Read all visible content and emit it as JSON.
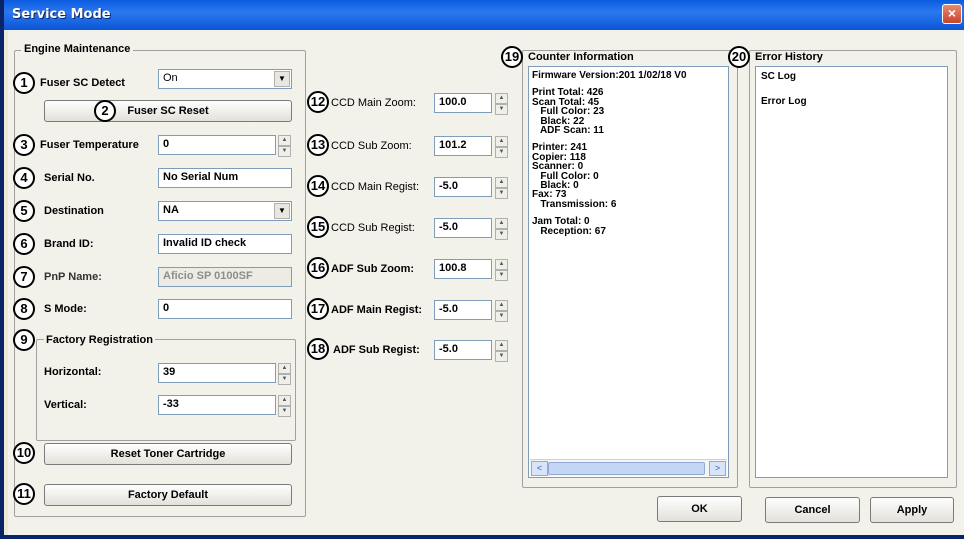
{
  "window": {
    "title": "Service Mode",
    "close": "×"
  },
  "engine": {
    "group_label": "Engine Maintenance",
    "fuser_sc_detect": {
      "label": "Fuser SC Detect",
      "value": "On"
    },
    "fuser_sc_reset": "Fuser SC Reset",
    "fuser_temperature": {
      "label": "Fuser Temperature",
      "value": "0"
    },
    "serial_no": {
      "label": "Serial No.",
      "value": "No Serial Num"
    },
    "destination": {
      "label": "Destination",
      "value": "NA"
    },
    "brand_id": {
      "label": "Brand ID:",
      "value": "Invalid ID check"
    },
    "pnp_name": {
      "label": "PnP Name:",
      "value": "Aficio SP 0100SF"
    },
    "s_mode": {
      "label": "S Mode:",
      "value": "0"
    },
    "factory_registration": {
      "group_label": "Factory Registration",
      "horizontal": {
        "label": "Horizontal:",
        "value": "39"
      },
      "vertical": {
        "label": "Vertical:",
        "value": "-33"
      }
    },
    "reset_toner": "Reset Toner Cartridge",
    "factory_default": "Factory Default"
  },
  "scanner": {
    "ccd_main_zoom": {
      "label": "CCD Main Zoom:",
      "value": "100.0"
    },
    "ccd_sub_zoom": {
      "label": "CCD Sub Zoom:",
      "value": "101.2"
    },
    "ccd_main_regist": {
      "label": "CCD Main Regist:",
      "value": "-5.0"
    },
    "ccd_sub_regist": {
      "label": "CCD Sub Regist:",
      "value": "-5.0"
    },
    "adf_sub_zoom": {
      "label": "ADF Sub Zoom:",
      "value": "100.8"
    },
    "adf_main_regist": {
      "label": "ADF Main Regist:",
      "value": "-5.0"
    },
    "adf_sub_regist": {
      "label": "ADF Sub Regist:",
      "value": "-5.0"
    }
  },
  "counter": {
    "group_label": "Counter Information",
    "lines": [
      "Firmware Version:201 1/02/18 V0",
      "",
      "Print Total: 426",
      "Scan Total: 45",
      "   Full Color: 23",
      "   Black: 22",
      "   ADF Scan: 11",
      "",
      "Printer: 241",
      "Copier: 118",
      "Scanner: 0",
      "   Full Color: 0",
      "   Black: 0",
      "Fax: 73",
      "   Transmission: 6",
      "",
      "Jam Total: 0",
      "   Reception: 67"
    ]
  },
  "error_history": {
    "group_label": "Error History",
    "items": [
      "SC Log",
      "Error Log"
    ]
  },
  "buttons": {
    "ok": "OK",
    "cancel": "Cancel",
    "apply": "Apply"
  },
  "callouts": [
    "1",
    "2",
    "3",
    "4",
    "5",
    "6",
    "7",
    "8",
    "9",
    "10",
    "11",
    "12",
    "13",
    "14",
    "15",
    "16",
    "17",
    "18",
    "19",
    "20"
  ]
}
